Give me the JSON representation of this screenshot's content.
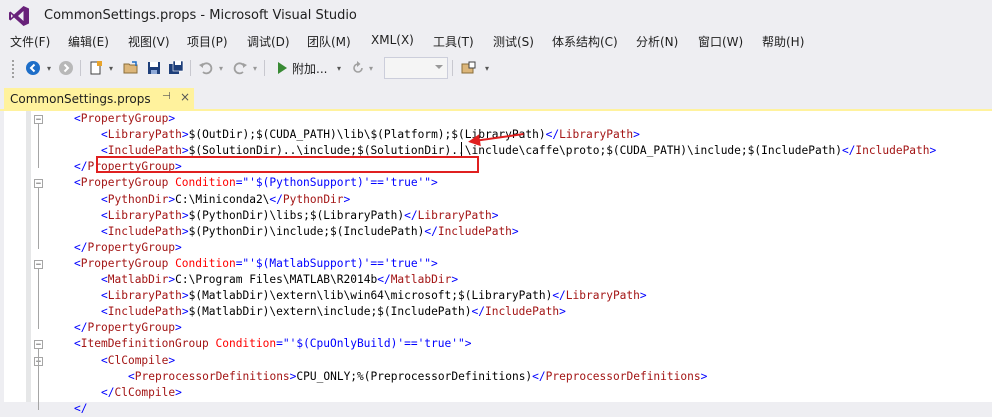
{
  "window": {
    "title": "CommonSettings.props - Microsoft Visual Studio"
  },
  "menubar": {
    "items": [
      "文件(F)",
      "编辑(E)",
      "视图(V)",
      "项目(P)",
      "调试(D)",
      "团队(M)",
      "XML(X)",
      "工具(T)",
      "测试(S)",
      "体系结构(C)",
      "分析(N)",
      "窗口(W)",
      "帮助(H)"
    ]
  },
  "toolbar": {
    "attach_label": "附加...",
    "icons": [
      "back-icon",
      "forward-icon",
      "new-project-icon",
      "open-file-icon",
      "save-icon",
      "save-all-icon",
      "undo-icon",
      "redo-icon",
      "start-icon",
      "refresh-icon",
      "find-icon"
    ]
  },
  "tab": {
    "label": "CommonSettings.props",
    "pin": "⊣",
    "close": "×"
  },
  "editor": {
    "lines": [
      [
        [
          "b",
          "<"
        ],
        [
          "t",
          "PropertyGroup"
        ],
        [
          "b",
          ">"
        ]
      ],
      [
        [
          "b",
          "<"
        ],
        [
          "t",
          "LibraryPath"
        ],
        [
          "b",
          ">"
        ],
        [
          "x",
          "$(OutDir);$(CUDA_PATH)\\lib\\$(Platform);$(LibraryPath)"
        ],
        [
          "b",
          "</"
        ],
        [
          "t",
          "LibraryPath"
        ],
        [
          "b",
          ">"
        ]
      ],
      [
        [
          "b",
          "<"
        ],
        [
          "t",
          "IncludePath"
        ],
        [
          "b",
          ">"
        ],
        [
          "x",
          "$(SolutionDir)..\\include;$(SolutionDir)..\\include\\caffe\\proto;$(CUDA_PATH)\\include;$(IncludePath)"
        ],
        [
          "b",
          "</"
        ],
        [
          "t",
          "IncludePath"
        ],
        [
          "b",
          ">"
        ]
      ],
      [
        [
          "b",
          "</"
        ],
        [
          "t",
          "PropertyGroup"
        ],
        [
          "b",
          ">"
        ]
      ],
      [
        [
          "b",
          "<"
        ],
        [
          "t",
          "PropertyGroup"
        ],
        [
          "x",
          " "
        ],
        [
          "a",
          "Condition"
        ],
        [
          "b",
          "=\""
        ],
        [
          "b",
          "'$(PythonSupport)'=='true'"
        ],
        [
          "b",
          "\">"
        ]
      ],
      [
        [
          "b",
          "<"
        ],
        [
          "t",
          "PythonDir"
        ],
        [
          "b",
          ">"
        ],
        [
          "x",
          "C:\\Miniconda2\\"
        ],
        [
          "b",
          "</"
        ],
        [
          "t",
          "PythonDir"
        ],
        [
          "b",
          ">"
        ]
      ],
      [
        [
          "b",
          "<"
        ],
        [
          "t",
          "LibraryPath"
        ],
        [
          "b",
          ">"
        ],
        [
          "x",
          "$(PythonDir)\\libs;$(LibraryPath)"
        ],
        [
          "b",
          "</"
        ],
        [
          "t",
          "LibraryPath"
        ],
        [
          "b",
          ">"
        ]
      ],
      [
        [
          "b",
          "<"
        ],
        [
          "t",
          "IncludePath"
        ],
        [
          "b",
          ">"
        ],
        [
          "x",
          "$(PythonDir)\\include;$(IncludePath)"
        ],
        [
          "b",
          "</"
        ],
        [
          "t",
          "IncludePath"
        ],
        [
          "b",
          ">"
        ]
      ],
      [
        [
          "b",
          "</"
        ],
        [
          "t",
          "PropertyGroup"
        ],
        [
          "b",
          ">"
        ]
      ],
      [
        [
          "b",
          "<"
        ],
        [
          "t",
          "PropertyGroup"
        ],
        [
          "x",
          " "
        ],
        [
          "a",
          "Condition"
        ],
        [
          "b",
          "=\""
        ],
        [
          "b",
          "'$(MatlabSupport)'=='true'"
        ],
        [
          "b",
          "\">"
        ]
      ],
      [
        [
          "b",
          "<"
        ],
        [
          "t",
          "MatlabDir"
        ],
        [
          "b",
          ">"
        ],
        [
          "x",
          "C:\\Program Files\\MATLAB\\R2014b"
        ],
        [
          "b",
          "</"
        ],
        [
          "t",
          "MatlabDir"
        ],
        [
          "b",
          ">"
        ]
      ],
      [
        [
          "b",
          "<"
        ],
        [
          "t",
          "LibraryPath"
        ],
        [
          "b",
          ">"
        ],
        [
          "x",
          "$(MatlabDir)\\extern\\lib\\win64\\microsoft;$(LibraryPath)"
        ],
        [
          "b",
          "</"
        ],
        [
          "t",
          "LibraryPath"
        ],
        [
          "b",
          ">"
        ]
      ],
      [
        [
          "b",
          "<"
        ],
        [
          "t",
          "IncludePath"
        ],
        [
          "b",
          ">"
        ],
        [
          "x",
          "$(MatlabDir)\\extern\\include;$(IncludePath)"
        ],
        [
          "b",
          "</"
        ],
        [
          "t",
          "IncludePath"
        ],
        [
          "b",
          ">"
        ]
      ],
      [
        [
          "b",
          "</"
        ],
        [
          "t",
          "PropertyGroup"
        ],
        [
          "b",
          ">"
        ]
      ],
      [
        [
          "b",
          "<"
        ],
        [
          "t",
          "ItemDefinitionGroup"
        ],
        [
          "x",
          " "
        ],
        [
          "a",
          "Condition"
        ],
        [
          "b",
          "=\""
        ],
        [
          "b",
          "'$(CpuOnlyBuild)'=='true'"
        ],
        [
          "b",
          "\">"
        ]
      ],
      [
        [
          "b",
          "<"
        ],
        [
          "t",
          "ClCompile"
        ],
        [
          "b",
          ">"
        ]
      ],
      [
        [
          "b",
          "<"
        ],
        [
          "t",
          "PreprocessorDefinitions"
        ],
        [
          "b",
          ">"
        ],
        [
          "x",
          "CPU_ONLY;%(PreprocessorDefinitions)"
        ],
        [
          "b",
          "</"
        ],
        [
          "t",
          "PreprocessorDefinitions"
        ],
        [
          "b",
          ">"
        ]
      ],
      [
        [
          "b",
          "</"
        ],
        [
          "t",
          "ClCompile"
        ],
        [
          "b",
          ">"
        ]
      ],
      [
        [
          "b",
          "</"
        ]
      ]
    ]
  }
}
